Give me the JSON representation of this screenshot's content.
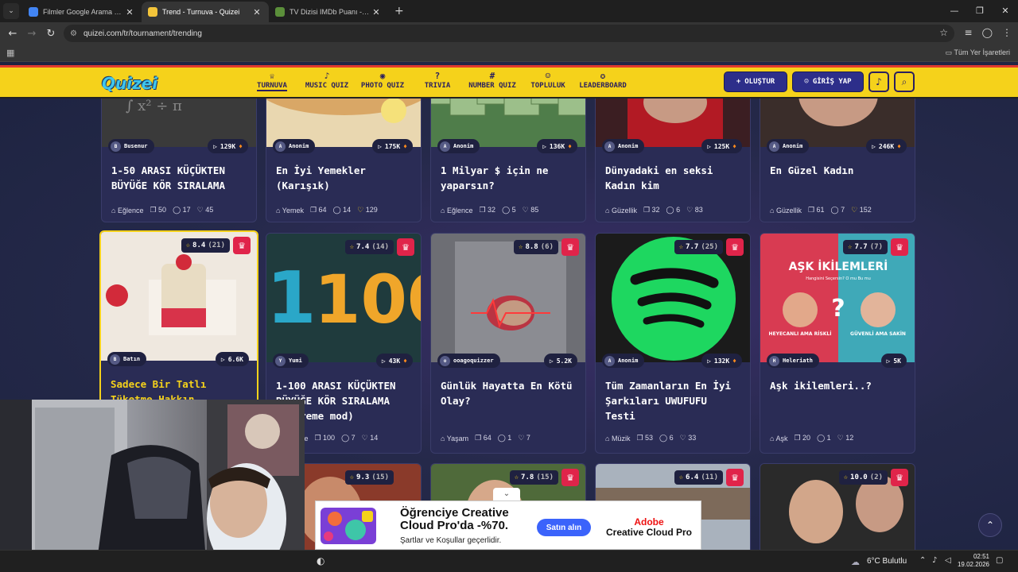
{
  "browser": {
    "tabs": [
      {
        "title": "Filmler Google Arama Sayısı - G",
        "active": false
      },
      {
        "title": "Trend - Turnuva - Quizei",
        "active": true
      },
      {
        "title": "TV Dizisi IMDb Puanı - Quizei",
        "active": false
      }
    ],
    "url": "quizei.com/tr/tournament/trending",
    "bookmarks_all": "Tüm Yer İşaretleri"
  },
  "site": {
    "logo": "Quizei",
    "nav": [
      {
        "label": "TURNUVA",
        "icon": "trophy-icon",
        "glyph": "♕",
        "active": true
      },
      {
        "label": "MUSIC QUIZ",
        "icon": "music-icon",
        "glyph": "♪",
        "active": false
      },
      {
        "label": "PHOTO QUIZ",
        "icon": "camera-icon",
        "glyph": "◉",
        "active": false
      },
      {
        "label": "TRIVIA",
        "icon": "question-icon",
        "glyph": "?",
        "active": false
      },
      {
        "label": "NUMBER QUIZ",
        "icon": "hash-icon",
        "glyph": "#",
        "active": false
      },
      {
        "label": "TOPLULUK",
        "icon": "users-icon",
        "glyph": "☺",
        "active": false
      },
      {
        "label": "LEADERBOARD",
        "icon": "medal-icon",
        "glyph": "✪",
        "active": false
      }
    ],
    "create_label": "OLUŞTUR",
    "login_label": "GİRİŞ YAP"
  },
  "cards_row1": [
    {
      "author": "Busenur",
      "plays": "129K",
      "hot": true,
      "title": "1-50 ARASI KÜÇÜKTEN BÜYÜĞE KÖR SIRALAMA",
      "category": "Eğlence",
      "items": "50",
      "comments": "17",
      "likes": "45",
      "liked": false
    },
    {
      "author": "Anonim",
      "plays": "175K",
      "hot": true,
      "title": "En İyi Yemekler (Karışık)",
      "category": "Yemek",
      "items": "64",
      "comments": "14",
      "likes": "129",
      "liked": true
    },
    {
      "author": "Anonim",
      "plays": "136K",
      "hot": true,
      "title": "1 Milyar $ için ne yaparsın?",
      "category": "Eğlence",
      "items": "32",
      "comments": "5",
      "likes": "85",
      "liked": false
    },
    {
      "author": "Anonim",
      "plays": "125K",
      "hot": true,
      "title": "Dünyadaki en seksi Kadın kim",
      "category": "Güzellik",
      "items": "32",
      "comments": "6",
      "likes": "83",
      "liked": false
    },
    {
      "author": "Anonim",
      "plays": "246K",
      "hot": true,
      "title": "En Güzel Kadın",
      "category": "Güzellik",
      "items": "61",
      "comments": "7",
      "likes": "152",
      "liked": true
    }
  ],
  "cards_row2": [
    {
      "rating": "8.4",
      "rating_count": "(21)",
      "author": "Batın",
      "plays": "6.6K",
      "hot": false,
      "title": "Sadece Bir Tatlı Tüketme Hakkın",
      "highlight": true,
      "category": "",
      "items": "",
      "comments": "",
      "likes": ""
    },
    {
      "rating": "7.4",
      "rating_count": "(14)",
      "author": "Yumi",
      "plays": "43K",
      "hot": true,
      "title": "1-100 ARASI KÜÇÜKTEN BÜYÜĞE KÖR SIRALAMA (extreme mod)",
      "category": "Eğlence",
      "items": "100",
      "comments": "7",
      "likes": "14"
    },
    {
      "rating": "8.8",
      "rating_count": "(6)",
      "author": "ooagoquizzer",
      "plays": "5.2K",
      "hot": false,
      "title": "Günlük Hayatta En Kötü Olay?",
      "category": "Yaşam",
      "items": "64",
      "comments": "1",
      "likes": "7"
    },
    {
      "rating": "7.7",
      "rating_count": "(25)",
      "author": "Anonim",
      "plays": "132K",
      "hot": true,
      "title": "Tüm Zamanların En İyi Şarkıları UWUFUFU Testi",
      "category": "Müzik",
      "items": "53",
      "comments": "6",
      "likes": "33"
    },
    {
      "rating": "7.7",
      "rating_count": "(7)",
      "author": "Heleriath",
      "plays": "5K",
      "hot": false,
      "title": "Aşk ikilemleri..?",
      "category": "Aşk",
      "items": "20",
      "comments": "1",
      "likes": "12"
    }
  ],
  "cards_row3": [
    {
      "rating": "9.3",
      "rating_count": "(15)"
    },
    {
      "rating": "7.8",
      "rating_count": "(15)"
    },
    {
      "rating": "6.4",
      "rating_count": "(11)"
    },
    {
      "rating": "10.0",
      "rating_count": "(2)"
    }
  ],
  "images": {
    "card2_3_text": "1100",
    "card2_5_title": "AŞK İKİLEMLERİ",
    "card2_5_sub": "Hangisini Seçersin? O mu Bu mu",
    "card2_5_left": "HEYECANLI AMA RİSKLİ",
    "card2_5_right": "GÜVENLİ AMA SAKİN"
  },
  "ad": {
    "headline": "Öğrenciye Creative Cloud Pro'da -%70.",
    "sub": "Şartlar ve Koşullar geçerlidir.",
    "cta": "Satın alın",
    "brand": "Adobe",
    "product": "Creative Cloud Pro"
  },
  "taskbar": {
    "weather": "6°C Bulutlu",
    "time": "02:51",
    "date": "19.02.2026"
  }
}
